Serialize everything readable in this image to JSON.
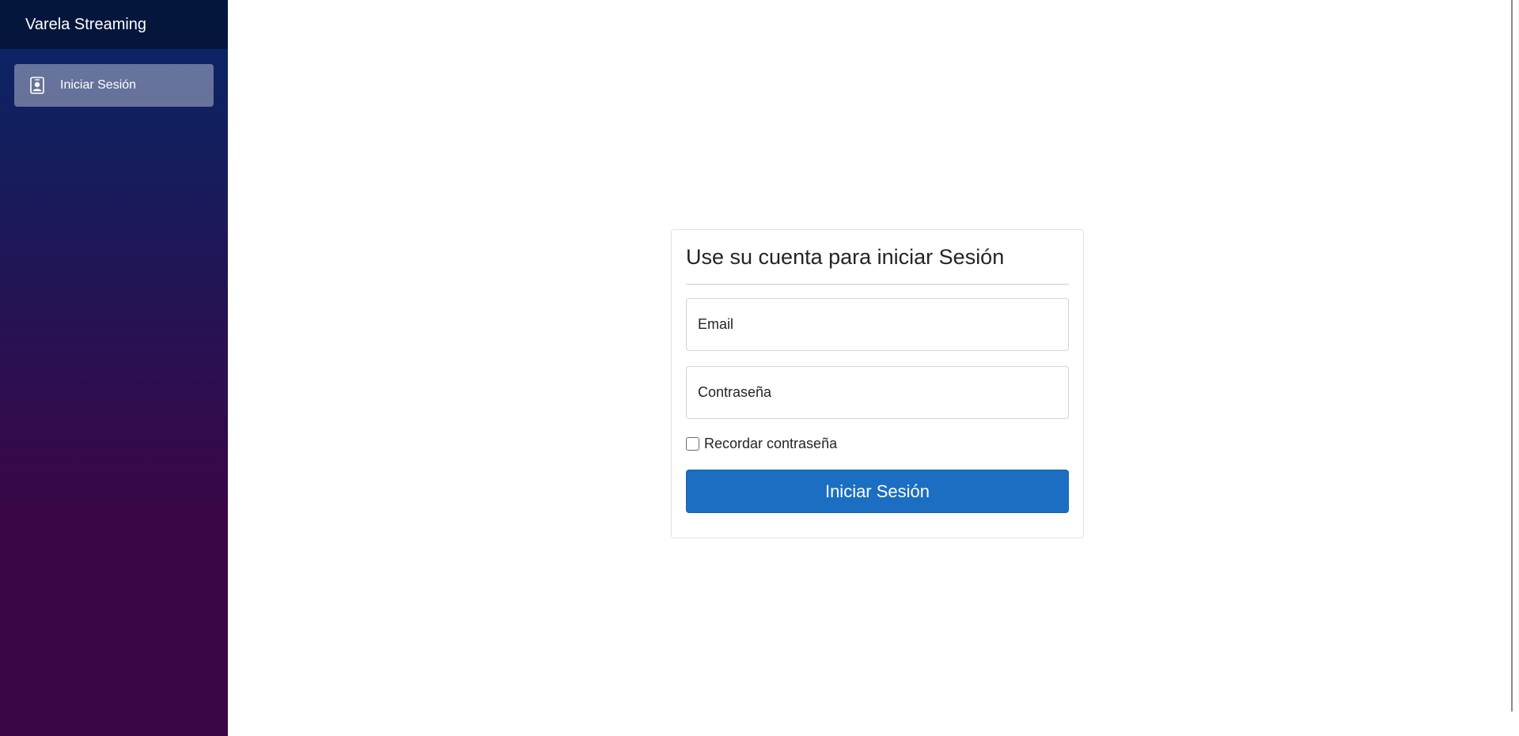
{
  "sidebar": {
    "brand": "Varela Streaming",
    "items": [
      {
        "label": "Iniciar Sesión",
        "icon": "person-badge-icon",
        "active": true
      }
    ]
  },
  "login": {
    "title": "Use su cuenta para iniciar Sesión",
    "email_label": "Email",
    "password_label": "Contraseña",
    "remember_label": "Recordar contraseña",
    "remember_checked": false,
    "submit_label": "Iniciar Sesión"
  },
  "colors": {
    "sidebar_gradient_top": "#052767",
    "sidebar_gradient_bottom": "#3a0647",
    "primary_button": "#1b6ec2"
  }
}
